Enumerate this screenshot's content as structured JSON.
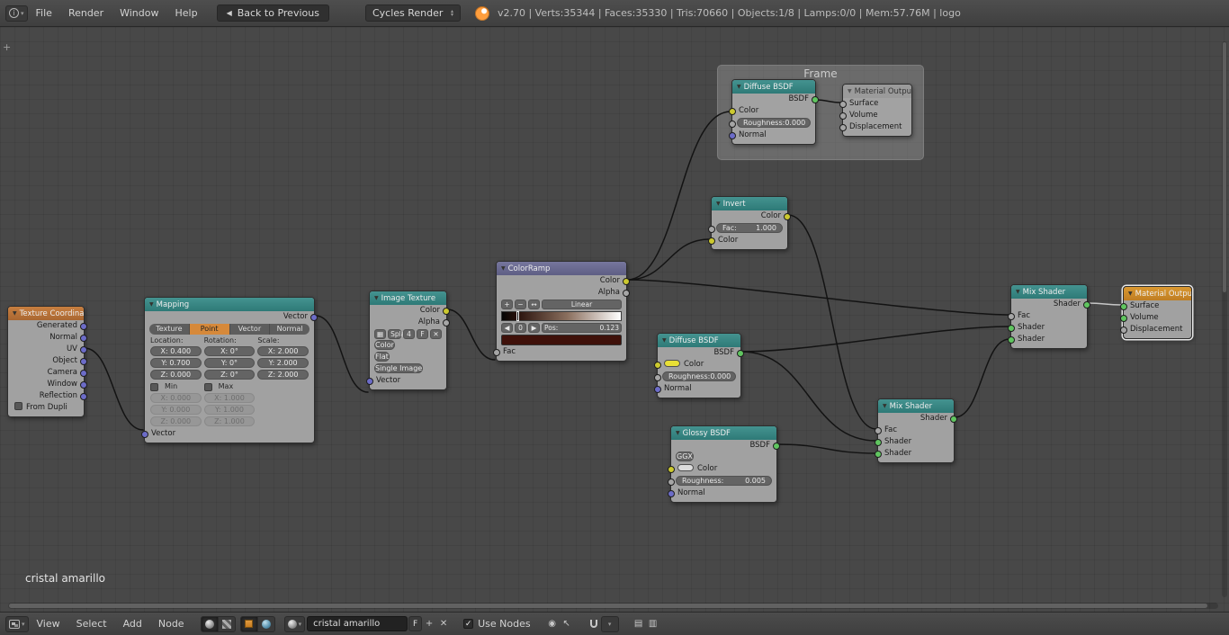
{
  "icons": {
    "tri": "▼",
    "dropdown": "▾",
    "up": "▴",
    "back": "◀",
    "step_left": "◀",
    "step_right": "▶",
    "plus": "+",
    "minus": "−",
    "flip": "↔",
    "close": "✕",
    "check": "✓",
    "info": "i",
    "image": "▦",
    "auto_render": "◉",
    "parent": "↖",
    "copy": "▤",
    "paste": "▥"
  },
  "colors": {
    "accent_orange": "#d6893a",
    "header_teal": "#3a8a87",
    "socket_shader": "#60c560",
    "socket_color": "#ccc92f",
    "socket_vector": "#6c6cc8",
    "socket_value": "#a6a6a6"
  },
  "top_bar": {
    "menu_file": "File",
    "menu_render": "Render",
    "menu_window": "Window",
    "menu_help": "Help",
    "back_button": "Back to Previous",
    "engine": "Cycles Render",
    "stats": "v2.70 | Verts:35344 | Faces:35330 | Tris:70660 | Objects:1/8 | Lamps:0/0 | Mem:57.76M | logo"
  },
  "canvas": {
    "annotation": "cristal amarillo",
    "frame_label": "Frame"
  },
  "nodes": {
    "texcoord": {
      "title": "Texture Coordinate",
      "out_generated": "Generated",
      "out_normal": "Normal",
      "out_uv": "UV",
      "out_object": "Object",
      "out_camera": "Camera",
      "out_window": "Window",
      "out_reflection": "Reflection",
      "from_dupli": "From Dupli"
    },
    "mapping": {
      "title": "Mapping",
      "out_vector": "Vector",
      "btn_texture": "Texture",
      "btn_point": "Point",
      "btn_vector": "Vector",
      "btn_normal": "Normal",
      "lbl_location": "Location:",
      "lbl_rotation": "Rotation:",
      "lbl_scale": "Scale:",
      "loc_x": "X: 0.400",
      "loc_y": "Y: 0.700",
      "loc_z": "Z: 0.000",
      "rot_x": "X: 0°",
      "rot_y": "Y: 0°",
      "rot_z": "Z: 0°",
      "scl_x": "X: 2.000",
      "scl_y": "Y: 2.000",
      "scl_z": "Z: 2.000",
      "lbl_min": "Min",
      "lbl_max": "Max",
      "min_x": "X: 0.000",
      "min_y": "Y: 0.000",
      "min_z": "Z: 0.000",
      "max_x": "X: 1.000",
      "max_y": "Y: 1.000",
      "max_z": "Z: 1.000",
      "in_vector": "Vector"
    },
    "image_texture": {
      "title": "Image Texture",
      "out_color": "Color",
      "out_alpha": "Alpha",
      "image_name": "Spla",
      "users": "4",
      "fake_user": "F",
      "color_space": "Color",
      "projection": "Flat",
      "source": "Single Image",
      "in_vector": "Vector"
    },
    "colorramp": {
      "title": "ColorRamp",
      "out_color": "Color",
      "out_alpha": "Alpha",
      "interpolation": "Linear",
      "index": "0",
      "pos_label": "Pos:",
      "pos_value": "0.123",
      "in_fac": "Fac"
    },
    "frame_diffuse": {
      "title": "Diffuse BSDF",
      "out_bsdf": "BSDF",
      "in_color": "Color",
      "roughness_label": "Roughness:",
      "roughness_value": "0.000",
      "in_normal": "Normal"
    },
    "frame_output": {
      "title": "Material Output",
      "in_surface": "Surface",
      "in_volume": "Volume",
      "in_displacement": "Displacement"
    },
    "invert": {
      "title": "Invert",
      "out_color": "Color",
      "fac_label": "Fac:",
      "fac_value": "1.000",
      "in_color": "Color"
    },
    "diffuse": {
      "title": "Diffuse BSDF",
      "out_bsdf": "BSDF",
      "in_color": "Color",
      "roughness_label": "Roughness:",
      "roughness_value": "0.000",
      "in_normal": "Normal"
    },
    "glossy": {
      "title": "Glossy BSDF",
      "out_bsdf": "BSDF",
      "distribution": "GGX",
      "in_color": "Color",
      "roughness_label": "Roughness:",
      "roughness_value": "0.005",
      "in_normal": "Normal"
    },
    "mix1": {
      "title": "Mix Shader",
      "out_shader": "Shader",
      "in_fac": "Fac",
      "in_shader1": "Shader",
      "in_shader2": "Shader"
    },
    "mix2": {
      "title": "Mix Shader",
      "out_shader": "Shader",
      "in_fac": "Fac",
      "in_shader1": "Shader",
      "in_shader2": "Shader"
    },
    "output": {
      "title": "Material Output",
      "in_surface": "Surface",
      "in_volume": "Volume",
      "in_displacement": "Displacement"
    }
  },
  "footer": {
    "menu_view": "View",
    "menu_select": "Select",
    "menu_add": "Add",
    "menu_node": "Node",
    "material_name": "cristal amarillo",
    "fake_user": "F",
    "use_nodes": "Use Nodes"
  }
}
